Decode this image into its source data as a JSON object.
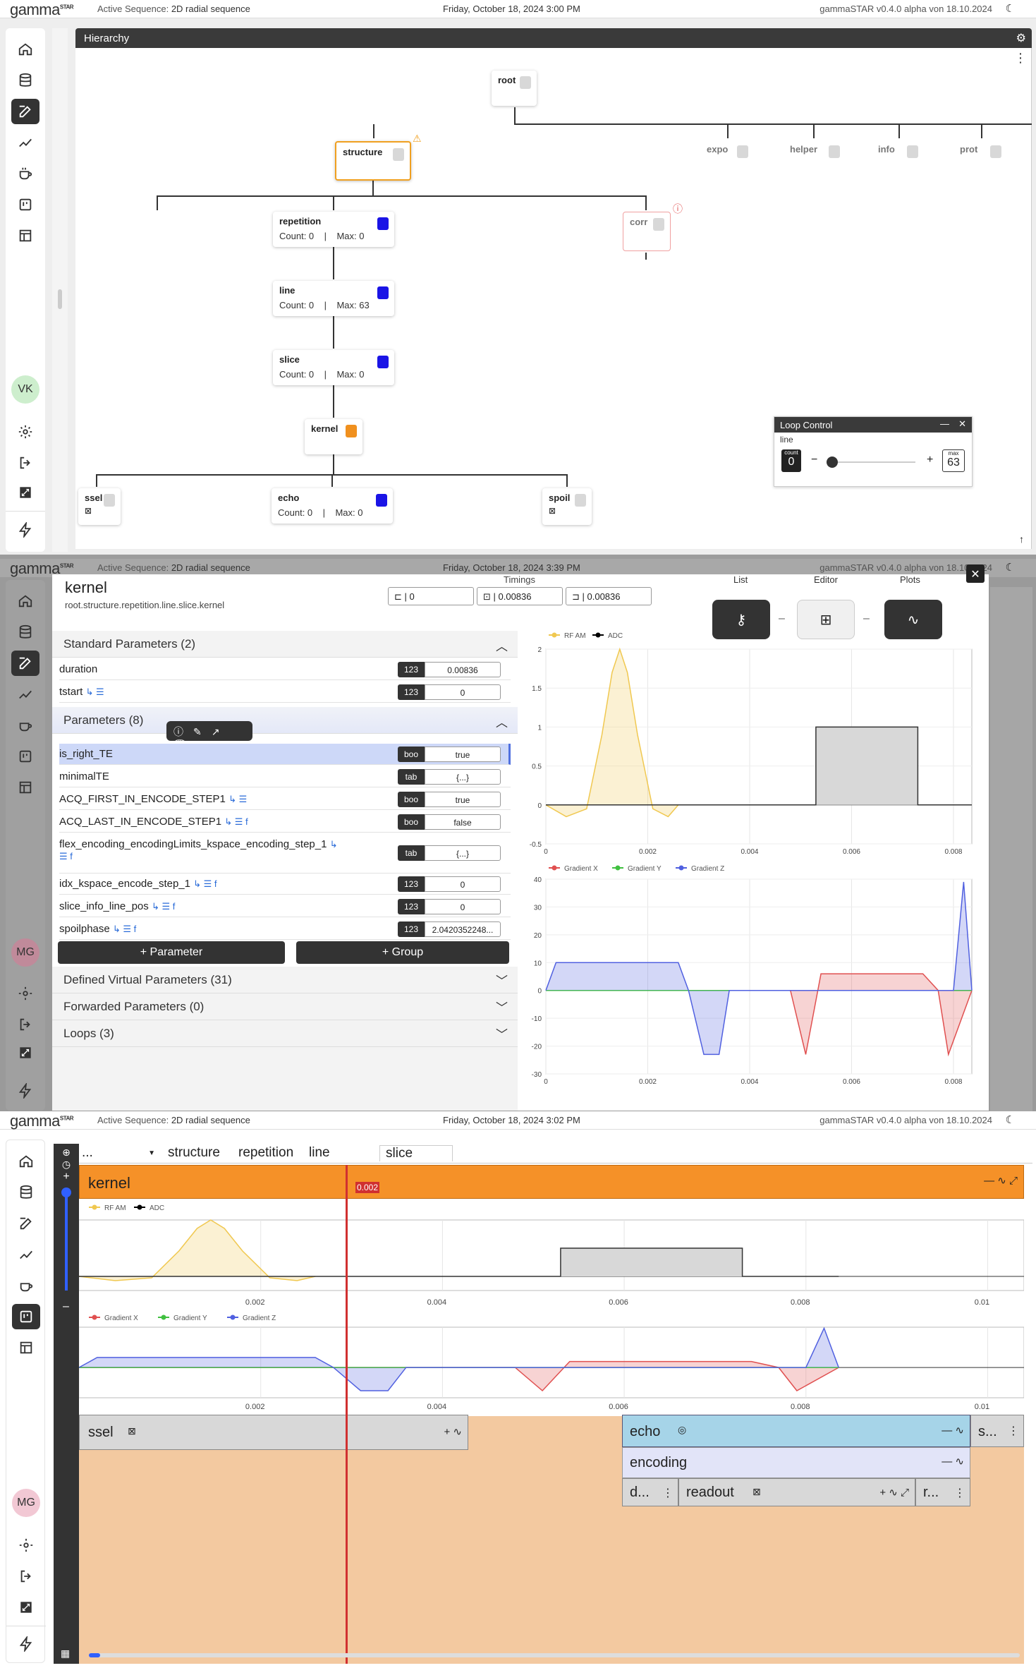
{
  "topbars": [
    {
      "logo": "gamma",
      "logo_sup": "STAR",
      "seq_label": "Active Sequence:",
      "seq_name": "2D radial sequence",
      "date": "Friday, October 18, 2024 3:00 PM",
      "version": "gammaSTAR v0.4.0 alpha von 18.10.2024"
    },
    {
      "logo": "gamma",
      "logo_sup": "STAR",
      "seq_label": "Active Sequence:",
      "seq_name": "2D radial sequence",
      "date": "Friday, October 18, 2024 3:39 PM",
      "version": "gammaSTAR v0.4.0 alpha von 18.10.2024"
    },
    {
      "logo": "gamma",
      "logo_sup": "STAR",
      "seq_label": "Active Sequence:",
      "seq_name": "2D radial sequence",
      "date": "Friday, October 18, 2024 3:02 PM",
      "version": "gammaSTAR v0.4.0 alpha von 18.10.2024"
    }
  ],
  "avatars": [
    "VK",
    "MG",
    "MG"
  ],
  "hierarchy": {
    "title": "Hierarchy",
    "nodes": {
      "root": "root",
      "structure": "structure",
      "expo": "expo",
      "helper": "helper",
      "info": "info",
      "prot": "prot",
      "repetition": "repetition",
      "corr": "corr",
      "line": "line",
      "slice": "slice",
      "kernel": "kernel",
      "ssel": "ssel",
      "echo": "echo",
      "spoil": "spoil"
    },
    "counts": {
      "repetition": {
        "count": "Count: 0",
        "sep": "|",
        "max": "Max: 0"
      },
      "line": {
        "count": "Count: 0",
        "sep": "|",
        "max": "Max: 63"
      },
      "slice": {
        "count": "Count: 0",
        "sep": "|",
        "max": "Max: 0"
      },
      "echo": {
        "count": "Count: 0",
        "sep": "|",
        "max": "Max: 0"
      }
    },
    "colors": {
      "blue": "#1a14e6",
      "orange": "#f0901e",
      "warn": "#f0a020",
      "error": "#e05050"
    },
    "loop_control": {
      "title": "Loop Control",
      "loop": "line",
      "count_label": "count",
      "count": "0",
      "max_label": "max",
      "max": "63",
      "minus": "−",
      "plus": "+"
    }
  },
  "kernel": {
    "title": "kernel",
    "path": "root.structure.repetition.line.slice.kernel",
    "timings_label": "Timings",
    "timings": [
      "0",
      "0.00836",
      "0.00836"
    ],
    "views": {
      "list": "List",
      "editor": "Editor",
      "plots": "Plots",
      "sep": "–"
    },
    "standard_section": "Standard Parameters (2)",
    "standard_params": [
      {
        "name": "duration",
        "type": "123",
        "value": "0.00836"
      },
      {
        "name": "tstart",
        "type": "123",
        "value": "0"
      }
    ],
    "params_section": "Parameters (8)",
    "params": [
      {
        "name": "is_right_TE",
        "type": "boo",
        "value": "true"
      },
      {
        "name": "minimalTE",
        "type": "tab",
        "value": "{...}"
      },
      {
        "name": "ACQ_FIRST_IN_ENCODE_STEP1",
        "type": "boo",
        "value": "true"
      },
      {
        "name": "ACQ_LAST_IN_ENCODE_STEP1",
        "type": "boo",
        "value": "false"
      },
      {
        "name": "flex_encoding_encodingLimits_kspace_encoding_step_1",
        "type": "tab",
        "value": "{...}"
      },
      {
        "name": "idx_kspace_encode_step_1",
        "type": "123",
        "value": "0"
      },
      {
        "name": "slice_info_line_pos",
        "type": "123",
        "value": "0"
      },
      {
        "name": "spoilphase",
        "type": "123",
        "value": "2.0420352248..."
      }
    ],
    "add_parameter": "+ Parameter",
    "add_group": "+ Group",
    "collapsed_sections": [
      "Defined Virtual Parameters (31)",
      "Forwarded Parameters (0)",
      "Loops (3)"
    ]
  },
  "chart_data": [
    {
      "type": "line",
      "title": "",
      "series": [
        {
          "name": "RF AM",
          "color": "#f0c850",
          "x": [
            0,
            0.0004,
            0.0008,
            0.0011,
            0.0013,
            0.00145,
            0.0016,
            0.0018,
            0.0021,
            0.0024,
            0.0026
          ],
          "y": [
            0,
            -0.15,
            -0.05,
            0.9,
            1.7,
            2.0,
            1.7,
            0.9,
            -0.05,
            -0.15,
            0
          ]
        },
        {
          "name": "ADC",
          "color": "#000000",
          "x": [
            0,
            0.0053,
            0.0053,
            0.0073,
            0.0073,
            0.00836
          ],
          "y": [
            0,
            0,
            1,
            1,
            0,
            0
          ]
        }
      ],
      "xlim": [
        0,
        0.00836
      ],
      "ylim": [
        -0.5,
        2
      ],
      "xticks": [
        "0",
        "0.002",
        "0.004",
        "0.006",
        "0.008"
      ],
      "yticks": [
        "2",
        "1.5",
        "1",
        "0.5",
        "0",
        "-0.5"
      ]
    },
    {
      "type": "area",
      "title": "",
      "series": [
        {
          "name": "Gradient X",
          "color": "#e05050",
          "x": [
            0,
            0.0048,
            0.0051,
            0.0054,
            0.0074,
            0.0077,
            0.0079,
            0.00836
          ],
          "y": [
            0,
            0,
            -23,
            6,
            6,
            0,
            -23,
            0
          ]
        },
        {
          "name": "Gradient Y",
          "color": "#40c040",
          "x": [
            0,
            0.00836
          ],
          "y": [
            0,
            0
          ]
        },
        {
          "name": "Gradient Z",
          "color": "#5060e0",
          "x": [
            0,
            0.0002,
            0.0026,
            0.0028,
            0.0031,
            0.0034,
            0.0036,
            0.0079,
            0.008,
            0.0082,
            0.00836
          ],
          "y": [
            0,
            10,
            10,
            0,
            -23,
            -23,
            0,
            0,
            0,
            39,
            0
          ]
        }
      ],
      "xlim": [
        0,
        0.00836
      ],
      "ylim": [
        -30,
        40
      ],
      "xticks": [
        "0",
        "0.002",
        "0.004",
        "0.006",
        "0.008"
      ],
      "yticks": [
        "40",
        "30",
        "20",
        "10",
        "0",
        "-10",
        "-20",
        "-30"
      ]
    }
  ],
  "timeline": {
    "breadcrumb": [
      "...",
      "structure",
      "repetition",
      "line",
      "slice"
    ],
    "kernel": "kernel",
    "cursor": "0.002",
    "ticks": [
      "0.002",
      "0.004",
      "0.006",
      "0.008",
      "0.01"
    ],
    "blocks": {
      "ssel": "ssel",
      "echo": "echo",
      "s": "s...",
      "encoding": "encoding",
      "d": "d...",
      "readout": "readout",
      "r": "r..."
    },
    "legend_rf": [
      "RF AM",
      "ADC"
    ],
    "legend_grad": [
      "Gradient X",
      "Gradient Y",
      "Gradient Z"
    ]
  }
}
